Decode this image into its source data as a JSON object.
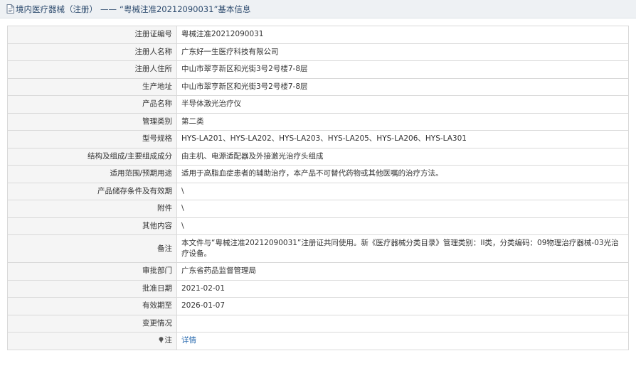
{
  "header": {
    "category": "境内医疗器械（注册）",
    "separator": "——",
    "title": "“粤械注准20212090031”基本信息"
  },
  "rows": [
    {
      "label": "注册证编号",
      "value": "粤械注准20212090031"
    },
    {
      "label": "注册人名称",
      "value": "广东好一生医疗科技有限公司"
    },
    {
      "label": "注册人住所",
      "value": "中山市翠亨新区和光街3号2号楼7-8层"
    },
    {
      "label": "生产地址",
      "value": "中山市翠亨新区和光街3号2号楼7-8层"
    },
    {
      "label": "产品名称",
      "value": "半导体激光治疗仪"
    },
    {
      "label": "管理类别",
      "value": "第二类"
    },
    {
      "label": "型号规格",
      "value": "HYS-LA201、HYS-LA202、HYS-LA203、HYS-LA205、HYS-LA206、HYS-LA301"
    },
    {
      "label": "结构及组成/主要组成成分",
      "value": "由主机、电源适配器及外接激光治疗头组成"
    },
    {
      "label": "适用范围/预期用途",
      "value": "适用于高脂血症患者的辅助治疗，本产品不可替代药物或其他医嘱的治疗方法。"
    },
    {
      "label": "产品储存条件及有效期",
      "value": "\\"
    },
    {
      "label": "附件",
      "value": "\\"
    },
    {
      "label": "其他内容",
      "value": "\\"
    },
    {
      "label": "备注",
      "value": "本文件与“粤械注准20212090031”注册证共同使用。新《医疗器械分类目录》管理类别：II类，分类编码：09物理治疗器械-03光治疗设备。"
    },
    {
      "label": "审批部门",
      "value": "广东省药品监督管理局"
    },
    {
      "label": "批准日期",
      "value": "2021-02-01"
    },
    {
      "label": "有效期至",
      "value": "2026-01-07"
    },
    {
      "label": "变更情况",
      "value": ""
    },
    {
      "label": "注",
      "value": "详情"
    }
  ],
  "colors": {
    "header_text": "#2d4b6e",
    "link": "#2b6cb0",
    "label_bg": "#f5f5f5",
    "border": "#d9d9d9"
  }
}
